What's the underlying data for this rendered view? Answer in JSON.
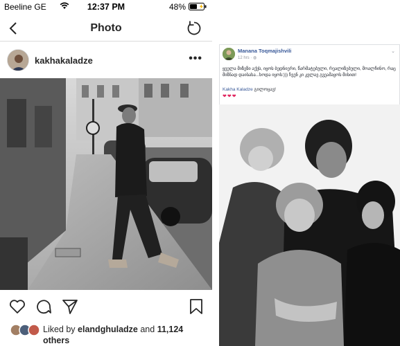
{
  "status_bar": {
    "carrier": "Beeline GE",
    "time": "12:37 PM",
    "battery": "48%"
  },
  "instagram": {
    "nav_title": "Photo",
    "username": "kakhakaladze",
    "more": "•••",
    "likes_prefix": "Liked by",
    "likes_user": "elandghuladze",
    "likes_and": "and",
    "likes_count": "11,124",
    "likes_suffix": "others"
  },
  "facebook": {
    "author": "Manana Toqmajishvili",
    "time": "12 hrs",
    "privacy_icon": "globe-icon",
    "body": "ყველა მიზეზი აქვს, იყოს ბედნიერი, წარმატებული, რეალიზებული, მოალჩინო, რაც მიზნად დაისახა...ხოდა იყოს:))) ჩვენ კი კვლავ გვეამაყოს მისით!",
    "mention_name": "Kakha Kaladze",
    "mention_suffix": "გილოცავ!",
    "hearts": "❤❤❤"
  },
  "colors": {
    "fb_link": "#385898",
    "ig_text": "#262626",
    "heart": "#e0245e"
  }
}
